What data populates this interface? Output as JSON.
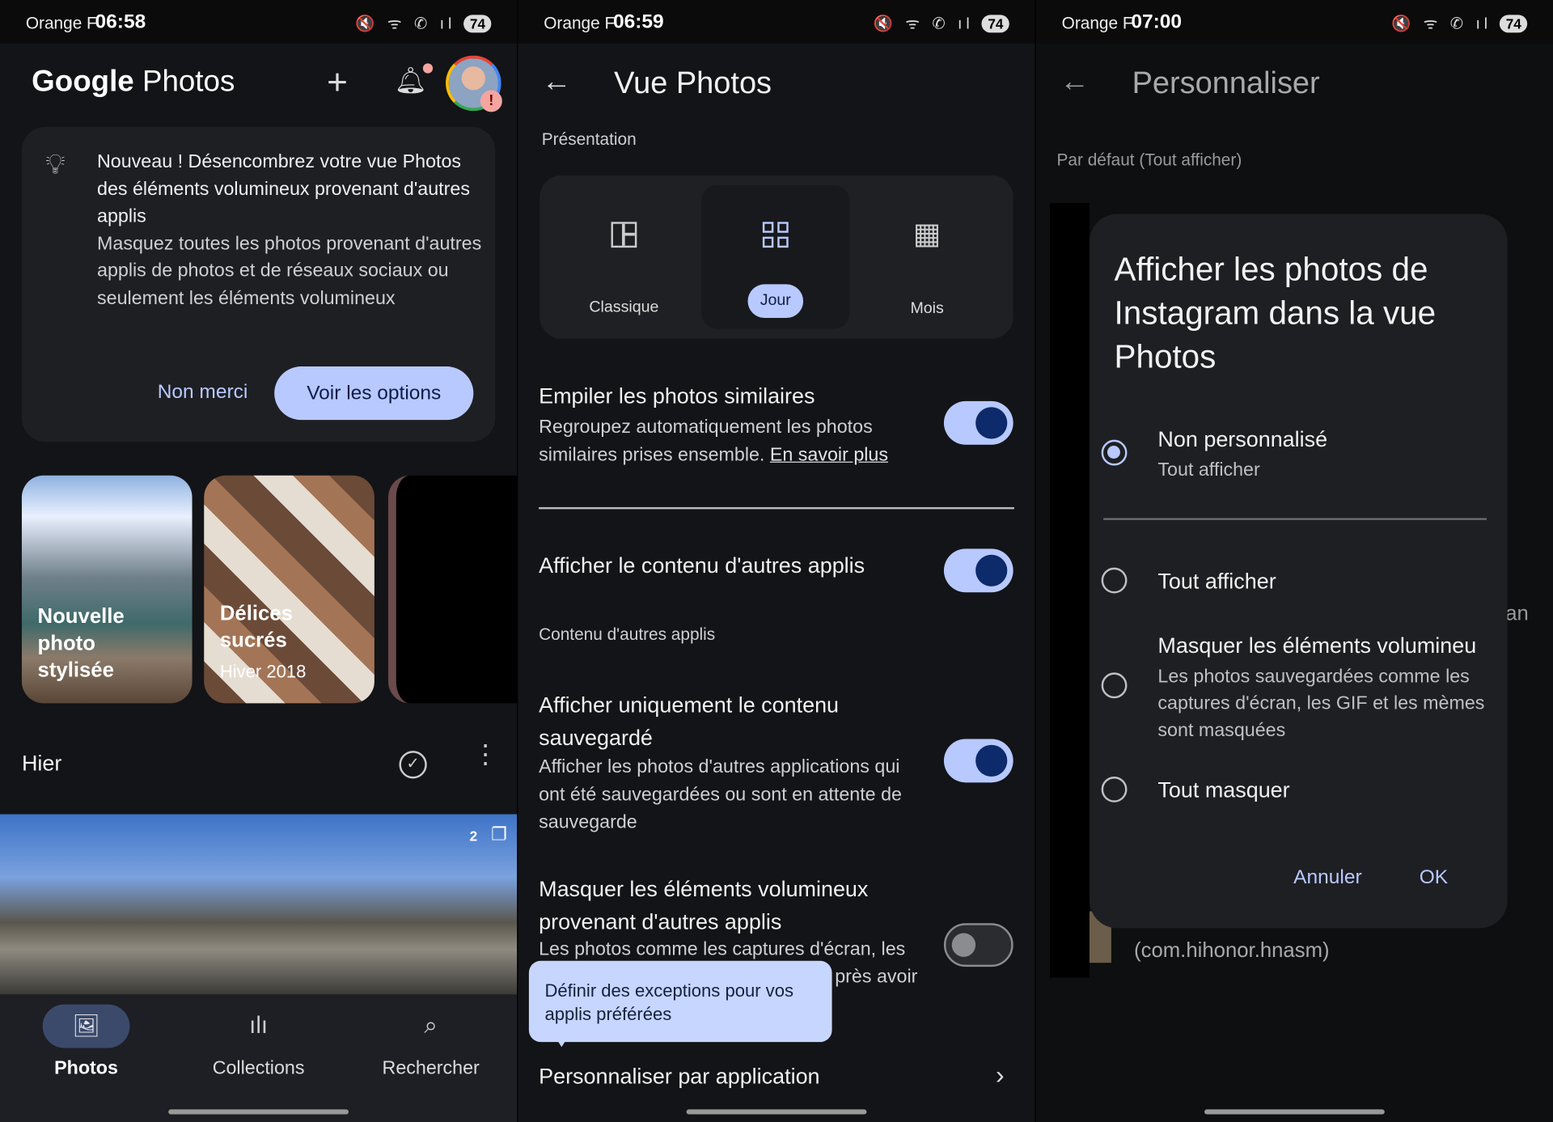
{
  "panels": [
    {
      "status": {
        "carrier": "Orange F",
        "time": "06:58",
        "battery": "74"
      },
      "app_title_google": "Google",
      "app_title_photos": "Photos",
      "promo": {
        "title": "Nouveau ! Désencombrez votre vue Photos des éléments volumineux provenant d'autres applis",
        "body": "Masquez toutes les photos provenant d'autres applis de photos et de réseaux sociaux ou seulement les éléments volumineux",
        "dismiss": "Non merci",
        "action": "Voir les options"
      },
      "memories": [
        {
          "title": "Nouvelle photo stylisée",
          "subtitle": ""
        },
        {
          "title": "Délices sucrés",
          "subtitle": "Hiver 2018"
        }
      ],
      "section_title": "Hier",
      "photo_stack_count": "2",
      "nav": [
        {
          "label": "Photos",
          "icon": "photo-icon",
          "active": true
        },
        {
          "label": "Collections",
          "icon": "collections-icon",
          "active": false
        },
        {
          "label": "Rechercher",
          "icon": "search-icon",
          "active": false
        }
      ]
    },
    {
      "status": {
        "carrier": "Orange F",
        "time": "06:59",
        "battery": "74"
      },
      "title": "Vue Photos",
      "presentation_label": "Présentation",
      "layouts": [
        {
          "label": "Classique",
          "selected": false
        },
        {
          "label": "Jour",
          "selected": true
        },
        {
          "label": "Mois",
          "selected": false
        }
      ],
      "settings": {
        "stack": {
          "title": "Empiler les photos similaires",
          "desc": "Regroupez automatiquement les photos similaires prises ensemble.",
          "link": "En savoir plus",
          "on": true
        },
        "other_apps": {
          "title": "Afficher le contenu d'autres applis",
          "on": true
        },
        "other_apps_section": "Contenu d'autres applis",
        "saved_only": {
          "title": "Afficher uniquement le contenu sauvegardé",
          "desc": "Afficher les photos d'autres applications qui ont été sauvegardées ou sont en attente de sauvegarde",
          "on": true
        },
        "hide_large": {
          "title": "Masquer les éléments volumineux provenant d'autres applis",
          "desc_visible_1": "Les photos comme les captures d'écran, les",
          "desc_visible_2": "près avoir",
          "on": false
        }
      },
      "tooltip": "Définir des exceptions pour vos applis préférées",
      "per_app": "Personnaliser par application"
    },
    {
      "status": {
        "carrier": "Orange F",
        "time": "07:00",
        "battery": "74"
      },
      "title": "Personnaliser",
      "default_label": "Par défaut (Tout afficher)",
      "behind_text_fragment": "an",
      "behind_package": "(com.hihonor.hnasm)",
      "dialog": {
        "title": "Afficher les photos de Instagram dans la vue Photos",
        "options": [
          {
            "label": "Non personnalisé",
            "desc": "Tout afficher",
            "selected": true
          },
          {
            "label": "Tout afficher",
            "desc": "",
            "selected": false
          },
          {
            "label": "Masquer les éléments volumineu",
            "desc": "Les photos sauvegardées comme les captures d'écran, les GIF et les mèmes sont masquées",
            "selected": false
          },
          {
            "label": "Tout masquer",
            "desc": "",
            "selected": false
          }
        ],
        "cancel": "Annuler",
        "ok": "OK"
      }
    }
  ],
  "colors": {
    "accent": "#b8c9ff",
    "background": "#131417",
    "card": "#1e1f23",
    "link": "#a8c0ff"
  }
}
